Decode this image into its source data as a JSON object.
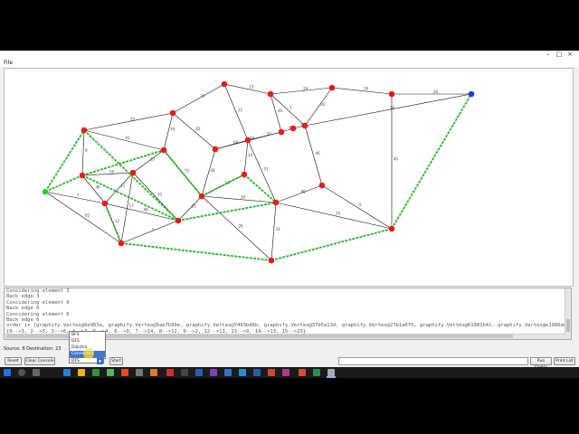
{
  "window": {
    "minimize_glyph": "–",
    "maximize_glyph": "□",
    "close_glyph": "×",
    "menu": [
      "File"
    ]
  },
  "graph": {
    "edge_color": "#111111",
    "path_color": "#2bb42b",
    "vertex_color": "#e51c1c",
    "source_color": "#28d428",
    "destination_color": "#1f3fe0",
    "edge_weights": [
      "7",
      "62",
      "61",
      "55",
      "9",
      "56",
      "11",
      "46",
      "17",
      "12",
      "70",
      "79",
      "62",
      "75",
      "48",
      "13",
      "21",
      "68",
      "34",
      "33",
      "51",
      "54",
      "26",
      "34",
      "24",
      "46",
      "1",
      "26",
      "74",
      "15",
      "34",
      "46",
      "80",
      "4",
      "40",
      "26",
      "35",
      "33",
      "5",
      "21",
      "33",
      "14",
      "33",
      "48",
      "93"
    ]
  },
  "console": {
    "lines": [
      "Considering element 3",
      "Back edge 3",
      "Considering element 0",
      "Back edge 0",
      "Considering element 6",
      "Back edge 6",
      "order is [graphify.Vertex@6e963a, graphify.Vertex@5ae7b99e, graphify.Vertex@7493bd6b, graphify.Vertex@37b5a13d, graphify.Vertex@27b1a675, graphify.Vertex@61981b41, graphify.Vertex@e1986dc,",
      "{0-->3, 2-->5, 3-->6, 4-->7, 5-->4, 6-->0, 7-->14, 8-->12, 9-->2, 12-->13, 13-->9, 14-->13, 15-->23}"
    ]
  },
  "status": {
    "text": "Source: 6   Destination: 23"
  },
  "controls": {
    "reset_label": "Reset",
    "clear_console_label": "Clear Console",
    "algorithm_selected": "DFS",
    "algorithm_options": [
      "BFS",
      "DFS",
      "Dijkstra",
      "Connected Comp..."
    ],
    "start_label": "Start",
    "run_query_label": "Run Query",
    "print_label": "Print List"
  }
}
